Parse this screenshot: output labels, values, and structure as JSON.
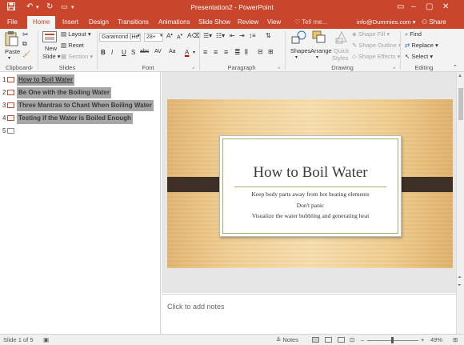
{
  "titlebar": {
    "title": "Presentation2 - PowerPoint",
    "icons": [
      "save-icon",
      "undo-icon",
      "redo-icon",
      "customize-icon",
      "ribbon-display-icon",
      "minimize-icon",
      "maximize-icon",
      "close-icon"
    ]
  },
  "tabs": [
    "File",
    "Home",
    "Insert",
    "Design",
    "Transitions",
    "Animations",
    "Slide Show",
    "Review",
    "View"
  ],
  "active_tab": "Home",
  "tell_me": "Tell me...",
  "account": "info@Dummies.com",
  "share": "Share",
  "ribbon": {
    "clipboard": {
      "label": "Clipboard",
      "paste": "Paste"
    },
    "slides": {
      "label": "Slides",
      "new_slide": "New",
      "new_slide2": "Slide",
      "layout": "Layout",
      "reset": "Reset",
      "section": "Section"
    },
    "font": {
      "label": "Font",
      "font_name": "Garamond (He...",
      "font_size": "28+",
      "buttons": [
        "B",
        "I",
        "U",
        "S",
        "abc",
        "AV",
        "Aa",
        "A"
      ]
    },
    "paragraph": {
      "label": "Paragraph"
    },
    "drawing": {
      "label": "Drawing",
      "shapes": "Shapes",
      "arrange": "Arrange",
      "quick_styles": "Quick",
      "quick_styles2": "Styles",
      "shape_fill": "Shape Fill",
      "shape_outline": "Shape Outline",
      "shape_effects": "Shape Effects"
    },
    "editing": {
      "label": "Editing",
      "find": "Find",
      "replace": "Replace",
      "select": "Select"
    }
  },
  "outline": [
    {
      "num": "1",
      "text": "How to Boil Water"
    },
    {
      "num": "2",
      "text": "Be One with the Boiling Water"
    },
    {
      "num": "3",
      "text": "Three Mantras to Chant When Boiling Water"
    },
    {
      "num": "4",
      "text": "Testing if the Water is Boiled Enough"
    },
    {
      "num": "5",
      "text": ""
    }
  ],
  "slide": {
    "title": "How to Boil Water",
    "bullets": [
      "Keep body parts away from hot heating elements",
      "Don't panic",
      "Visualize the water bubbling and generating heat"
    ]
  },
  "notes_placeholder": "Click to add notes",
  "status": {
    "slide_counter": "Slide 1 of 5",
    "notes": "Notes",
    "zoom": "49%"
  },
  "colors": {
    "accent": "#c9452b",
    "outline_highlight": "#a6a6a6",
    "slide_band": "#3e2f27",
    "card_rule": "#9db26a"
  }
}
